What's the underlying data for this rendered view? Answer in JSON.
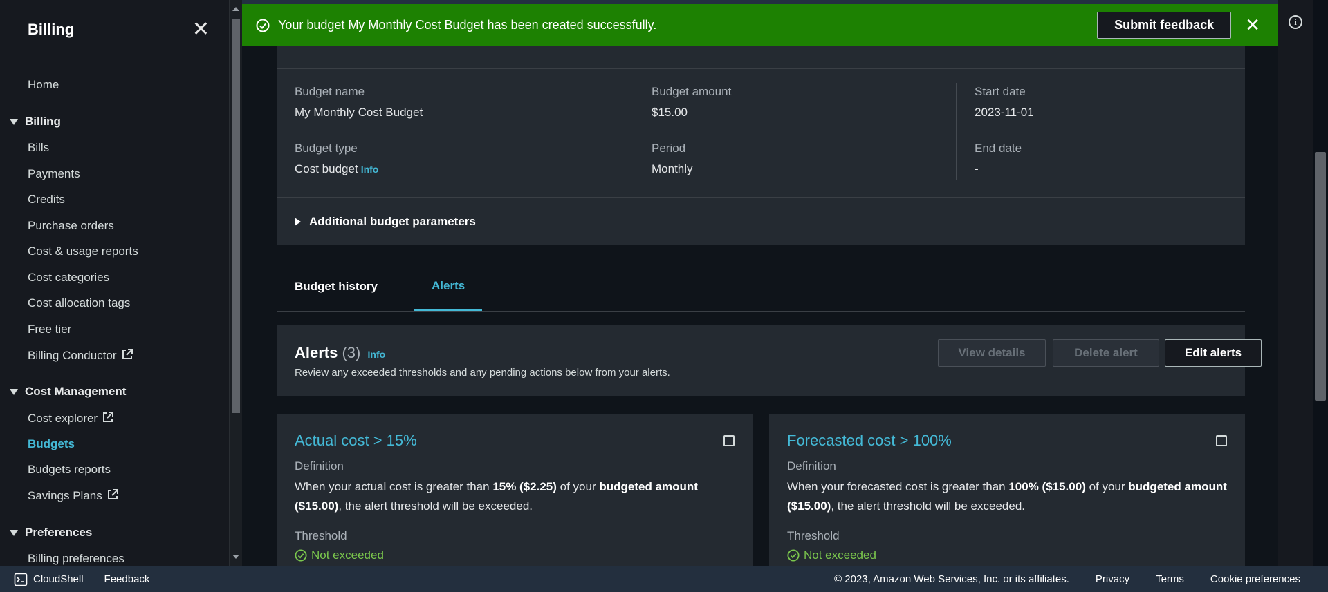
{
  "sidebar": {
    "title": "Billing",
    "home": "Home",
    "sections": [
      {
        "label": "Billing",
        "items": [
          "Bills",
          "Payments",
          "Credits",
          "Purchase orders",
          "Cost & usage reports",
          "Cost categories",
          "Cost allocation tags",
          "Free tier",
          "Billing Conductor"
        ]
      },
      {
        "label": "Cost Management",
        "items": [
          "Cost explorer",
          "Budgets",
          "Budgets reports",
          "Savings Plans"
        ]
      },
      {
        "label": "Preferences",
        "items": [
          "Billing preferences"
        ]
      }
    ],
    "active_item": "Budgets"
  },
  "flash": {
    "prefix": "Your budget ",
    "link": "My Monthly Cost Budget",
    "suffix": " has been created successfully.",
    "feedback_button": "Submit feedback"
  },
  "details": {
    "budget_name_label": "Budget name",
    "budget_name_value": "My Monthly Cost Budget",
    "budget_type_label": "Budget type",
    "budget_type_value": "Cost budget",
    "info": "Info",
    "budget_amount_label": "Budget amount",
    "budget_amount_value": "$15.00",
    "period_label": "Period",
    "period_value": "Monthly",
    "start_date_label": "Start date",
    "start_date_value": "2023-11-01",
    "end_date_label": "End date",
    "end_date_value": "-",
    "additional": "Additional budget parameters"
  },
  "tabs": {
    "history": "Budget history",
    "alerts": "Alerts"
  },
  "alerts": {
    "title": "Alerts",
    "count": "(3)",
    "info": "Info",
    "description": "Review any exceeded thresholds and any pending actions below from your alerts.",
    "view_details": "View details",
    "delete_alert": "Delete alert",
    "edit_alerts": "Edit alerts"
  },
  "cards": [
    {
      "title": "Actual cost > 15%",
      "definition_label": "Definition",
      "def_1": "When your actual cost is greater than ",
      "def_b1": "15% ($2.25)",
      "def_2": " of your ",
      "def_b2": "budgeted amount ($15.00)",
      "def_3": ", the alert threshold will be exceeded.",
      "threshold_label": "Threshold",
      "status": "Not exceeded"
    },
    {
      "title": "Forecasted cost > 100%",
      "definition_label": "Definition",
      "def_1": "When your forecasted cost is greater than ",
      "def_b1": "100% ($15.00)",
      "def_2": " of your ",
      "def_b2": "budgeted amount ($15.00)",
      "def_3": ", the alert threshold will be exceeded.",
      "threshold_label": "Threshold",
      "status": "Not exceeded"
    }
  ],
  "footer": {
    "cloudshell": "CloudShell",
    "feedback": "Feedback",
    "copyright": "© 2023, Amazon Web Services, Inc. or its affiliates.",
    "privacy": "Privacy",
    "terms": "Terms",
    "cookie": "Cookie preferences"
  },
  "colors": {
    "accent": "#44b9d6",
    "success": "#1d8102",
    "ok_text": "#7bc74d"
  }
}
